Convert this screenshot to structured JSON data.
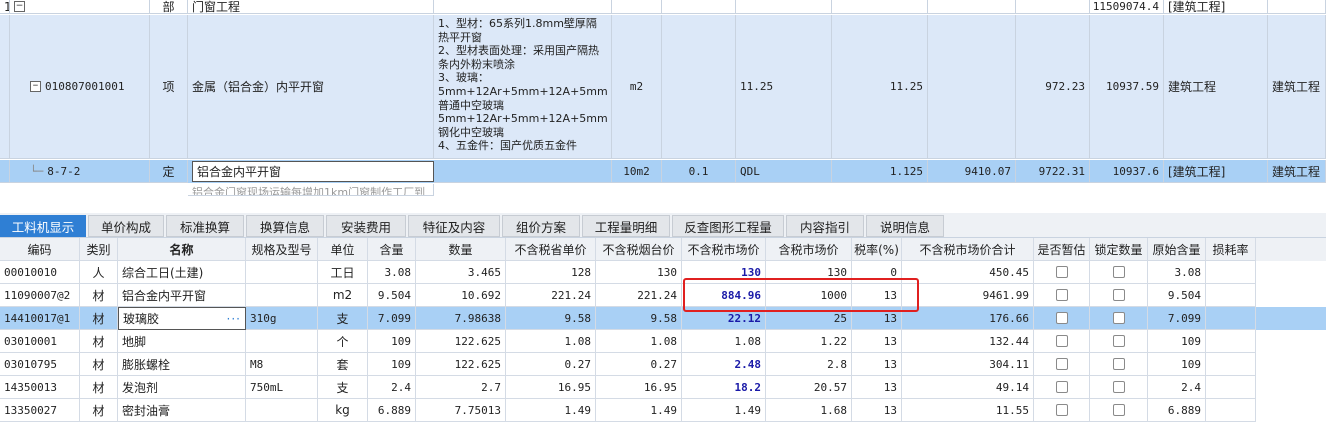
{
  "upper": {
    "row_top": {
      "col1": "1",
      "sub": "部",
      "name": "门窗工程",
      "total": "11509074.4",
      "category": "[建筑工程]"
    },
    "row_item": {
      "code": "010807001001",
      "type": "项",
      "name": "金属（铝合金）内平开窗",
      "desc": "1、型材：65系列1.8mm壁厚隔热平开窗\n2、型材表面处理：采用国产隔热条内外粉末喷涂\n3、玻璃：\n5mm+12Ar+5mm+12A+5mm普通中空玻璃\n5mm+12Ar+5mm+12A+5mm钢化中空玻璃\n4、五金件：国产优质五金件",
      "unit": "m2",
      "qty_expr": "11.25",
      "qty": "11.25",
      "price": "972.23",
      "total": "10937.59",
      "category": "建筑工程",
      "specialty": "建筑工程"
    },
    "row_quota": {
      "code": "8-7-2",
      "type": "定",
      "name": "铝合金内平开窗",
      "unit": "10m2",
      "content": "0.1",
      "qty_expr": "QDL",
      "qty": "1.125",
      "price_a": "9410.07",
      "price": "9722.31",
      "total": "10937.6",
      "category": "[建筑工程]",
      "specialty": "建筑工程"
    },
    "row_partial": {
      "name": "铝合金门窗现场运输每增加1km门窗制作工厂到"
    }
  },
  "tabs": [
    "工料机显示",
    "单价构成",
    "标准换算",
    "换算信息",
    "安装费用",
    "特征及内容",
    "组价方案",
    "工程量明细",
    "反查图形工程量",
    "内容指引",
    "说明信息"
  ],
  "table": {
    "headers": [
      "编码",
      "类别",
      "名称",
      "规格及型号",
      "单位",
      "含量",
      "数量",
      "不含税省单价",
      "不含税烟台价",
      "不含税市场价",
      "含税市场价",
      "税率(%)",
      "不含税市场价合计",
      "是否暂估",
      "锁定数量",
      "原始含量",
      "损耗率"
    ],
    "rows": [
      {
        "code": "00010010",
        "type": "人",
        "name": "综合工日(土建)",
        "spec": "",
        "unit": "工日",
        "content": "3.08",
        "qty": "3.465",
        "prov_price": "128",
        "yt_price": "130",
        "mkt_price": "130",
        "tax_price": "130",
        "rate": "0",
        "total": "450.45",
        "provisional": false,
        "lock": true,
        "orig": "3.08",
        "loss": ""
      },
      {
        "code": "11090007@2",
        "type": "材",
        "name": "铝合金内平开窗",
        "spec": "",
        "unit": "m2",
        "content": "9.504",
        "qty": "10.692",
        "prov_price": "221.24",
        "yt_price": "221.24",
        "mkt_price": "884.96",
        "tax_price": "1000",
        "rate": "13",
        "total": "9461.99",
        "provisional": true,
        "lock": true,
        "orig": "9.504",
        "loss": ""
      },
      {
        "code": "14410017@1",
        "type": "材",
        "name": "玻璃胶",
        "spec": "310g",
        "unit": "支",
        "content": "7.099",
        "qty": "7.98638",
        "prov_price": "9.58",
        "yt_price": "9.58",
        "mkt_price": "22.12",
        "tax_price": "25",
        "rate": "13",
        "total": "176.66",
        "provisional": true,
        "lock": true,
        "orig": "7.099",
        "loss": ""
      },
      {
        "code": "03010001",
        "type": "材",
        "name": "地脚",
        "spec": "",
        "unit": "个",
        "content": "109",
        "qty": "122.625",
        "prov_price": "1.08",
        "yt_price": "1.08",
        "mkt_price": "1.08",
        "tax_price": "1.22",
        "rate": "13",
        "total": "132.44",
        "provisional": true,
        "lock": true,
        "orig": "109",
        "loss": ""
      },
      {
        "code": "03010795",
        "type": "材",
        "name": "膨胀螺栓",
        "spec": "M8",
        "unit": "套",
        "content": "109",
        "qty": "122.625",
        "prov_price": "0.27",
        "yt_price": "0.27",
        "mkt_price": "2.48",
        "tax_price": "2.8",
        "rate": "13",
        "total": "304.11",
        "provisional": true,
        "lock": true,
        "orig": "109",
        "loss": ""
      },
      {
        "code": "14350013",
        "type": "材",
        "name": "发泡剂",
        "spec": "750mL",
        "unit": "支",
        "content": "2.4",
        "qty": "2.7",
        "prov_price": "16.95",
        "yt_price": "16.95",
        "mkt_price": "18.2",
        "tax_price": "20.57",
        "rate": "13",
        "total": "49.14",
        "provisional": true,
        "lock": true,
        "orig": "2.4",
        "loss": ""
      },
      {
        "code": "13350027",
        "type": "材",
        "name": "密封油膏",
        "spec": "",
        "unit": "kg",
        "content": "6.889",
        "qty": "7.75013",
        "prov_price": "1.49",
        "yt_price": "1.49",
        "mkt_price": "1.49",
        "tax_price": "1.68",
        "rate": "13",
        "total": "11.55",
        "provisional": true,
        "lock": true,
        "orig": "6.889",
        "loss": ""
      }
    ]
  },
  "icons": {
    "expander": "minus-box-icon",
    "more": "ellipsis-icon"
  },
  "colors": {
    "selected_row": "#a9d0f5",
    "item_row": "#dce8f8",
    "active_tab": "#2f7fd4",
    "highlight_box": "#e02020",
    "market_price_text": "#1a1aa8"
  }
}
